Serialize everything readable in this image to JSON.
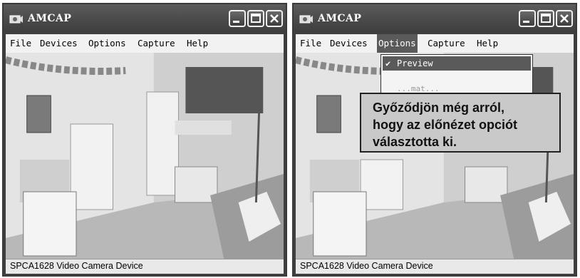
{
  "windows": [
    {
      "title": "AMCAP",
      "menu": [
        "File",
        "Devices",
        "Options",
        "Capture",
        "Help"
      ],
      "status": "SPCA1628 Video Camera Device"
    },
    {
      "title": "AMCAP",
      "menu": [
        "File",
        "Devices",
        "Options",
        "Capture",
        "Help"
      ],
      "active_menu": "Options",
      "dropdown": {
        "selected_item": "Preview",
        "checked": true,
        "partial_item": "...mat..."
      },
      "callout": "Győződjön még arról,\nhogy az előnézet opciót\nválasztotta ki.",
      "status": "SPCA1628 Video Camera Device"
    }
  ],
  "colors": {
    "window_frame": "#404040",
    "menu_bg": "#f2f2f2",
    "highlight": "#5a5a5a",
    "callout_bg": "#c9c9c9"
  },
  "icons": [
    "camera-icon",
    "minimize-icon",
    "maximize-icon",
    "close-icon",
    "checkmark-icon"
  ]
}
